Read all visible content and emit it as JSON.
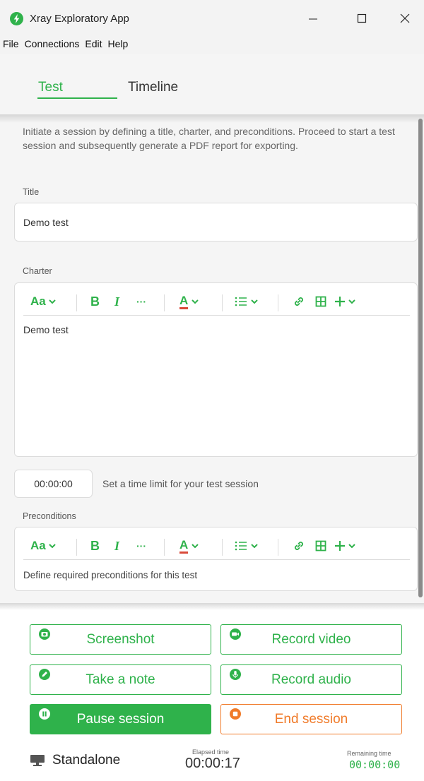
{
  "window": {
    "title": "Xray Exploratory App",
    "accent_color": "#2fb24b",
    "danger_color": "#f07b2a"
  },
  "menu": [
    "File",
    "Connections",
    "Edit",
    "Help"
  ],
  "tabs": [
    {
      "label": "Test",
      "active": true
    },
    {
      "label": "Timeline",
      "active": false
    }
  ],
  "intro_text": "Initiate a session by defining a title, charter, and preconditions. Proceed to start a test session and subsequently generate a PDF report for exporting.",
  "title_field": {
    "label": "Title",
    "value": "Demo test"
  },
  "charter_field": {
    "label": "Charter",
    "value": "Demo test"
  },
  "toolbar": {
    "font_style": "Aa",
    "bold": "B",
    "italic": "I",
    "more": "···",
    "font_color": "A"
  },
  "time_limit": {
    "value": "00:00:00",
    "hint": "Set a time limit for your test session"
  },
  "preconditions_field": {
    "label": "Preconditions",
    "placeholder": "Define required preconditions for this test"
  },
  "actions": {
    "screenshot": "Screenshot",
    "record_video": "Record video",
    "take_note": "Take a note",
    "record_audio": "Record audio",
    "pause_session": "Pause session",
    "end_session": "End session"
  },
  "status": {
    "mode": "Standalone",
    "elapsed_label": "Elapsed time",
    "elapsed_value": "00:00:17",
    "remaining_label": "Remaining time",
    "remaining_value": "00:00:00"
  }
}
